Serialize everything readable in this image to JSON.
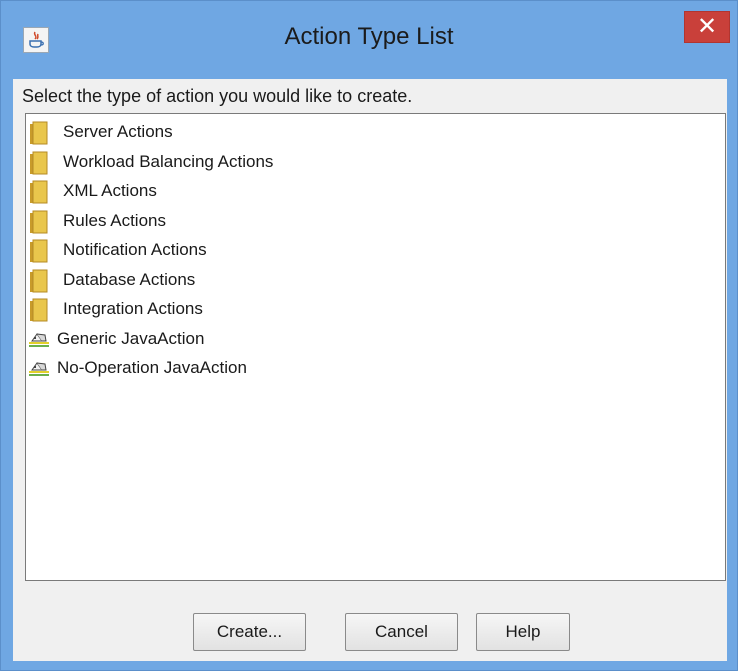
{
  "window": {
    "title": "Action Type List",
    "app_icon": "java-icon",
    "close_glyph": "✕"
  },
  "instruction": "Select the type of action you would like to create.",
  "tree": {
    "items": [
      {
        "label": "Server Actions",
        "icon": "folder-icon"
      },
      {
        "label": "Workload Balancing Actions",
        "icon": "folder-icon"
      },
      {
        "label": "XML Actions",
        "icon": "folder-icon"
      },
      {
        "label": "Rules Actions",
        "icon": "folder-icon"
      },
      {
        "label": "Notification Actions",
        "icon": "folder-icon"
      },
      {
        "label": "Database Actions",
        "icon": "folder-icon"
      },
      {
        "label": "Integration Actions",
        "icon": "folder-icon"
      },
      {
        "label": "Generic JavaAction",
        "icon": "java-action-icon"
      },
      {
        "label": "No-Operation JavaAction",
        "icon": "java-action-icon"
      }
    ]
  },
  "buttons": {
    "create": "Create...",
    "cancel": "Cancel",
    "help": "Help"
  },
  "colors": {
    "titlebar": "#6fa7e3",
    "close_button": "#c9403a",
    "folder": "#e9c64c"
  }
}
